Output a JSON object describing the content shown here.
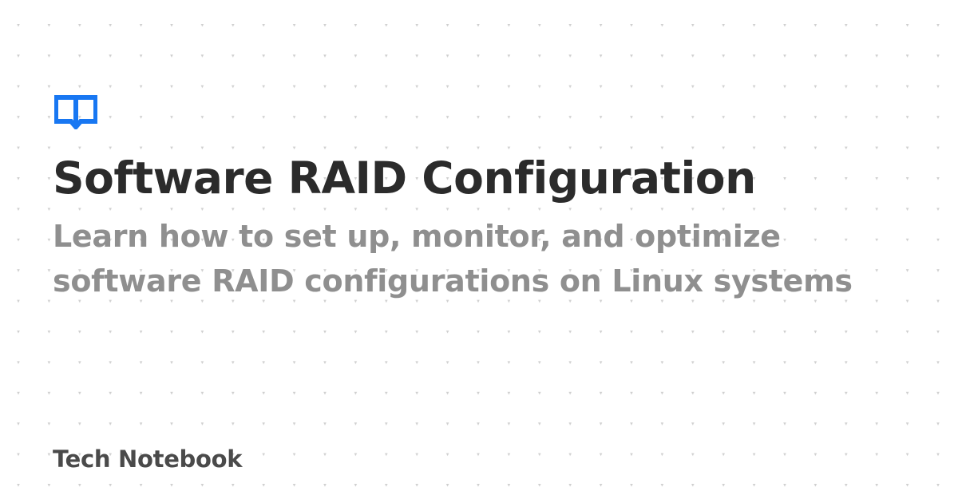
{
  "colors": {
    "background": "#ffffff",
    "accent": "#1877f2",
    "title": "#2b2b2b",
    "subtitle": "#8f8f8f",
    "brand": "#4a4a4a",
    "dots": "#cfcfcf"
  },
  "logo": {
    "icon": "open-book-icon"
  },
  "title": "Software RAID Configuration",
  "subtitle": {
    "line1": "Learn how to set up, monitor, and optimize",
    "line2": "software RAID configurations on Linux systems"
  },
  "brand": "Tech Notebook"
}
